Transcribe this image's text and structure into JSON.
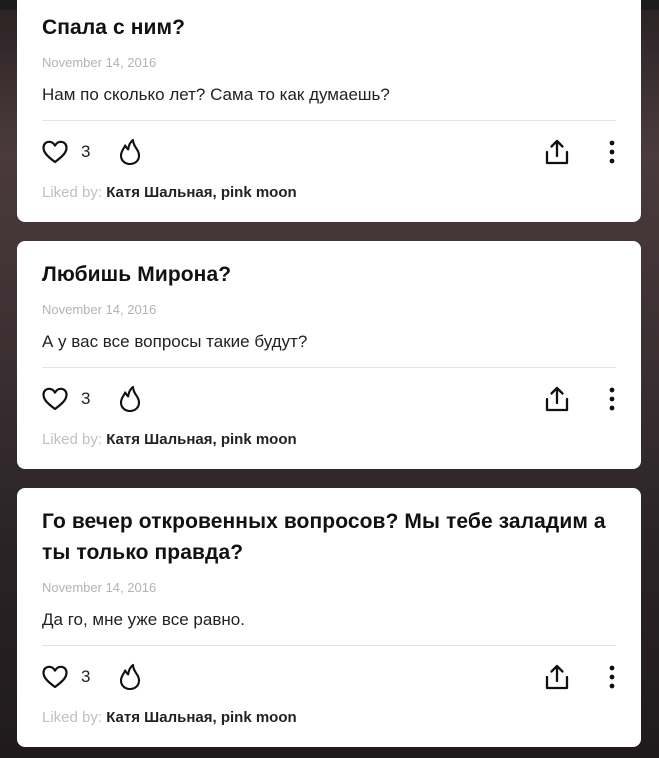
{
  "liked_by_label": "Liked by:",
  "cards": [
    {
      "question": "Спала с ним?",
      "date": "November 14, 2016",
      "answer": "Нам по сколько лет? Сама то как думаешь?",
      "likes": "3",
      "liked_names": "Катя Шальная, pink moon"
    },
    {
      "question": "Любишь Мирона?",
      "date": "November 14, 2016",
      "answer": "А у вас все вопросы такие будут?",
      "likes": "3",
      "liked_names": "Катя Шальная, pink moon"
    },
    {
      "question": "Го вечер откровенных вопросов? Мы тебе заладим а ты только правда?",
      "date": "November 14, 2016",
      "answer": "Да го, мне уже все равно.",
      "likes": "3",
      "liked_names": "Катя Шальная, pink moon"
    }
  ],
  "icons": {
    "like": "heart-icon",
    "fire": "fire-icon",
    "share": "share-icon",
    "more": "more-vertical-icon"
  }
}
